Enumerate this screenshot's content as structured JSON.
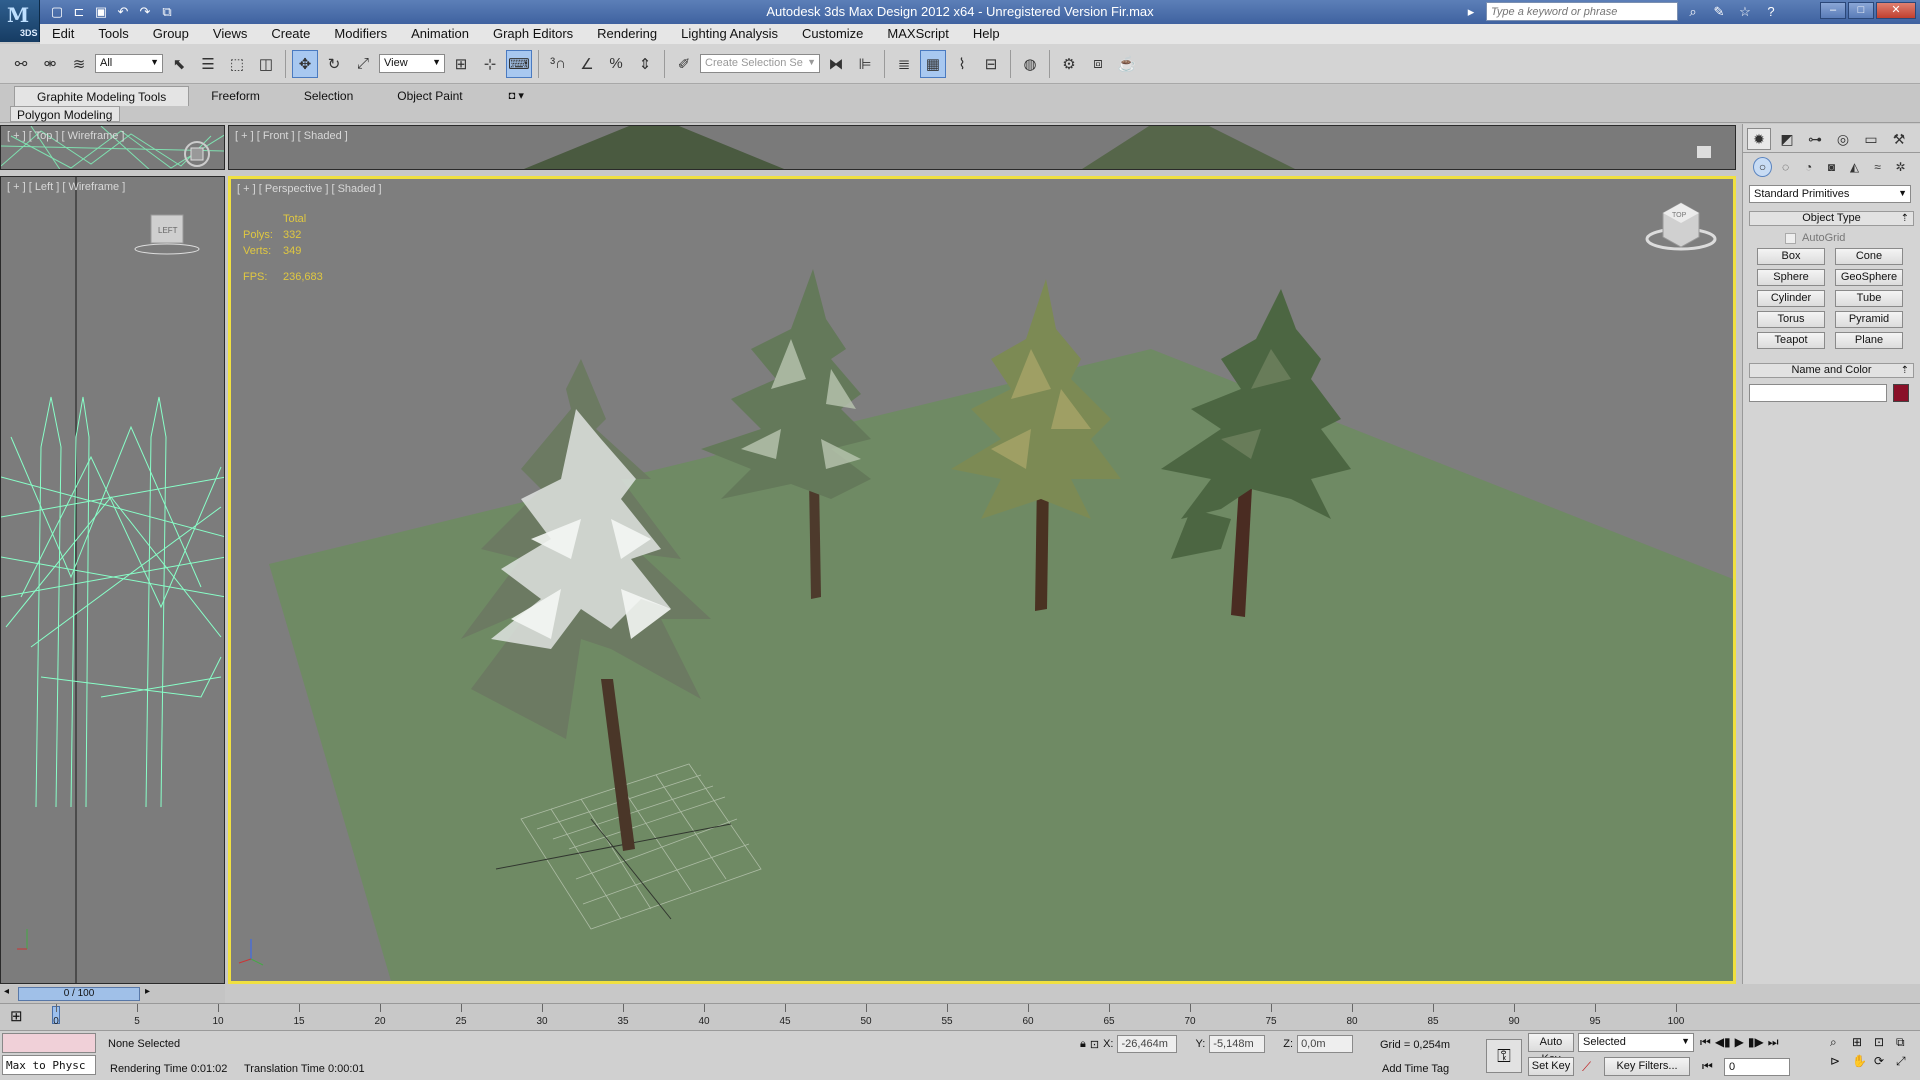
{
  "app": {
    "logo_text": "3DS",
    "title": "Autodesk 3ds Max Design 2012 x64  -  Unregistered Version    Fir.max",
    "search_placeholder": "Type a keyword or phrase"
  },
  "quick_access": [
    "new-icon",
    "open-icon",
    "save-icon",
    "undo-icon",
    "redo-icon",
    "project-icon"
  ],
  "menu": [
    "Edit",
    "Tools",
    "Group",
    "Views",
    "Create",
    "Modifiers",
    "Animation",
    "Graph Editors",
    "Rendering",
    "Lighting Analysis",
    "Customize",
    "MAXScript",
    "Help"
  ],
  "toolbar": {
    "selection_filter": "All",
    "ref_coord": "View",
    "named_selection_placeholder": "Create Selection Se"
  },
  "ribbon": {
    "tabs": [
      "Graphite Modeling Tools",
      "Freeform",
      "Selection",
      "Object Paint"
    ],
    "panel": "Polygon Modeling"
  },
  "viewports": {
    "top": "[ + ] [ Top ] [ Wireframe ]",
    "front": "[ + ] [ Front ] [ Shaded ]",
    "left": "[ + ] [ Left ] [ Wireframe ]",
    "perspective": "[ + ] [ Perspective ] [ Shaded ]",
    "viewcube_left": "LEFT",
    "viewcube_persp": "TOP"
  },
  "stats": {
    "header": "Total",
    "polys_label": "Polys:",
    "polys": "332",
    "verts_label": "Verts:",
    "verts": "349",
    "fps_label": "FPS:",
    "fps": "236,683"
  },
  "frame_counter": "0 / 100",
  "command_panel": {
    "category": "Standard Primitives",
    "object_type_header": "Object Type",
    "autogrid": "AutoGrid",
    "primitives": [
      "Box",
      "Cone",
      "Sphere",
      "GeoSphere",
      "Cylinder",
      "Tube",
      "Torus",
      "Pyramid",
      "Teapot",
      "Plane"
    ],
    "name_color_header": "Name and Color",
    "swatch_color": "#8a1028"
  },
  "timeline": {
    "ticks": [
      0,
      5,
      10,
      15,
      20,
      25,
      30,
      35,
      40,
      45,
      50,
      55,
      60,
      65,
      70,
      75,
      80,
      85,
      90,
      95,
      100
    ]
  },
  "status": {
    "script_text": "Max to Physc",
    "selection": "None Selected",
    "rendering_time": "Rendering Time  0:01:02",
    "translation_time": "Translation Time  0:00:01",
    "x_label": "X:",
    "x": "-26,464m",
    "y_label": "Y:",
    "y": "-5,148m",
    "z_label": "Z:",
    "z": "0,0m",
    "grid": "Grid = 0,254m",
    "add_time_tag": "Add Time Tag",
    "auto_key": "Auto Key",
    "set_key": "Set Key",
    "key_mode": "Selected",
    "key_filters": "Key Filters...",
    "frame": "0"
  },
  "colors": {
    "active_viewport_border": "#f0e040",
    "stats_text": "#e0c840",
    "ground": "#6f8a64"
  }
}
